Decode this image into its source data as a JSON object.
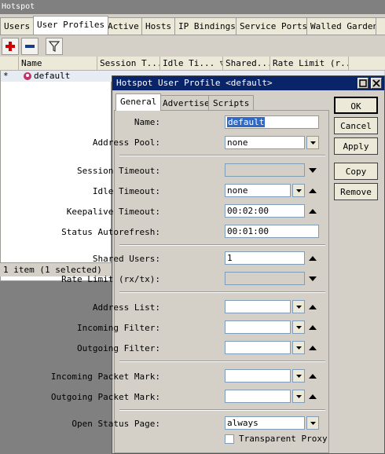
{
  "window": {
    "title": "Hotspot"
  },
  "tabs": [
    "Users",
    "User Profiles",
    "Active",
    "Hosts",
    "IP Bindings",
    "Service Ports",
    "Walled Garden",
    ""
  ],
  "table": {
    "headers": [
      "Name",
      "Session T...",
      "Idle Ti... ▽",
      "Shared...",
      "Rate Limit (r..."
    ],
    "row": {
      "marker": "*",
      "name": "default"
    },
    "status": "1 item (1 selected)"
  },
  "dialog": {
    "title": "Hotspot User Profile <default>",
    "tabs": [
      "General",
      "Advertise",
      "Scripts"
    ],
    "fields": {
      "name": {
        "label": "Name:",
        "value": "default"
      },
      "address_pool": {
        "label": "Address Pool:",
        "value": "none"
      },
      "session_timeout": {
        "label": "Session Timeout:",
        "value": ""
      },
      "idle_timeout": {
        "label": "Idle Timeout:",
        "value": "none"
      },
      "keepalive_timeout": {
        "label": "Keepalive Timeout:",
        "value": "00:02:00"
      },
      "status_autorefresh": {
        "label": "Status Autorefresh:",
        "value": "00:01:00"
      },
      "shared_users": {
        "label": "Shared Users:",
        "value": "1"
      },
      "rate_limit": {
        "label": "Rate Limit (rx/tx):",
        "value": ""
      },
      "address_list": {
        "label": "Address List:",
        "value": ""
      },
      "incoming_filter": {
        "label": "Incoming Filter:",
        "value": ""
      },
      "outgoing_filter": {
        "label": "Outgoing Filter:",
        "value": ""
      },
      "incoming_packet_mark": {
        "label": "Incoming Packet Mark:",
        "value": ""
      },
      "outgoing_packet_mark": {
        "label": "Outgoing Packet Mark:",
        "value": ""
      },
      "open_status_page": {
        "label": "Open Status Page:",
        "value": "always"
      },
      "transparent_proxy": {
        "label": "Transparent Proxy"
      }
    },
    "buttons": {
      "ok": "OK",
      "cancel": "Cancel",
      "apply": "Apply",
      "copy": "Copy",
      "remove": "Remove"
    }
  },
  "colors": {
    "title_bar": "#0a246a",
    "selection": "#316ac5",
    "add_icon": "#cc0000",
    "remove_icon": "#1a3a8a"
  }
}
